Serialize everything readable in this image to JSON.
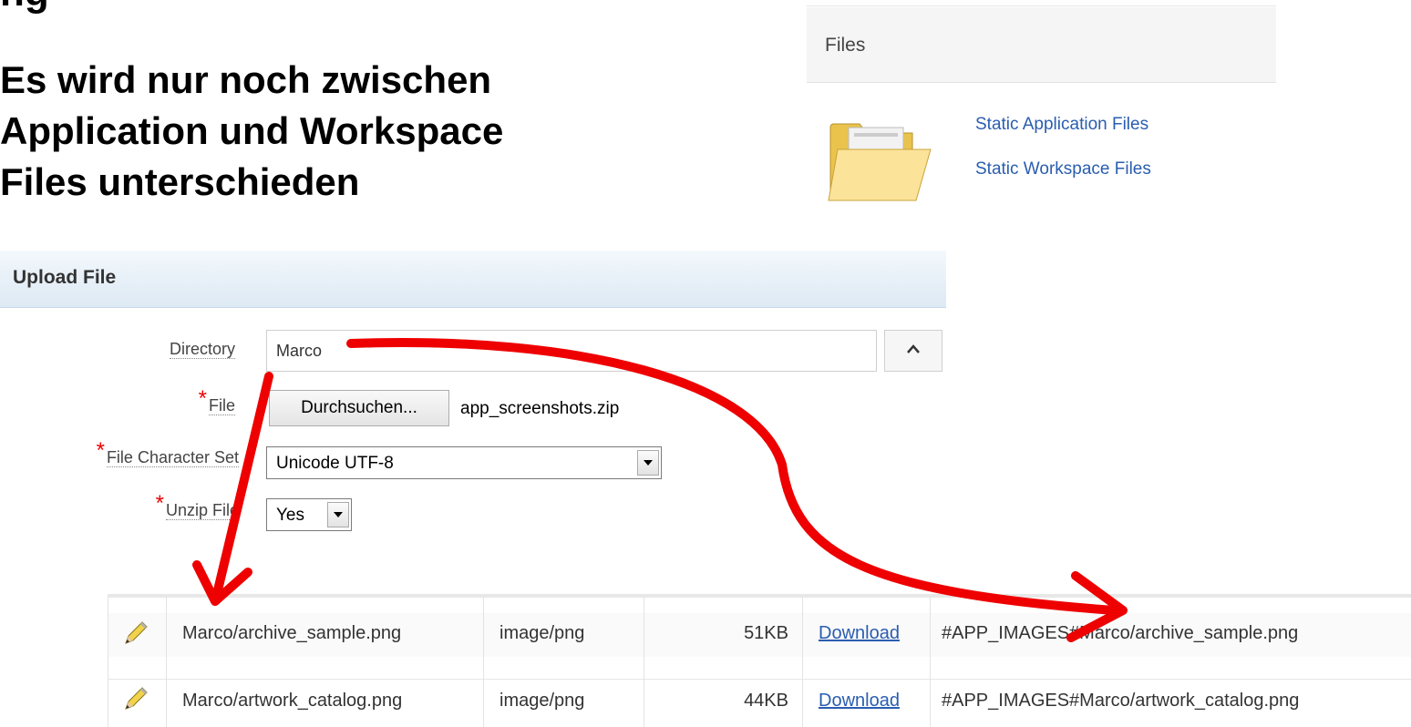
{
  "slide": {
    "title_cut": "ng",
    "text_lines": [
      "Es wird nur noch zwischen",
      "Application und Workspace",
      "Files unterschieden"
    ]
  },
  "files_panel": {
    "header": "Files",
    "links": [
      "Static Application Files",
      "Static Workspace Files"
    ]
  },
  "upload": {
    "header": "Upload File",
    "required_mark": "*",
    "directory": {
      "label": "Directory",
      "value": "Marco"
    },
    "file": {
      "label": "File",
      "button": "Durchsuchen...",
      "filename": "app_screenshots.zip"
    },
    "charset": {
      "label": "File Character Set",
      "value": "Unicode UTF-8"
    },
    "unzip": {
      "label": "Unzip File",
      "value": "Yes"
    }
  },
  "table": {
    "rows": [
      {
        "name": "Marco/archive_sample.png",
        "type": "image/png",
        "size": "51KB",
        "download": "Download",
        "reference": "#APP_IMAGES#Marco/archive_sample.png"
      },
      {
        "name": "Marco/artwork_catalog.png",
        "type": "image/png",
        "size": "44KB",
        "download": "Download",
        "reference": "#APP_IMAGES#Marco/artwork_catalog.png"
      }
    ]
  },
  "icons": {
    "folder": "folder-icon",
    "pencil": "pencil-edit-icon",
    "chevron": "chevron-up-icon",
    "dropdown": "dropdown-arrow-icon"
  },
  "colors": {
    "link": "#2a5db0",
    "required": "#ee0000",
    "annotation_arrow": "#ee0000",
    "upload_header_bg": "#dde9f4"
  }
}
